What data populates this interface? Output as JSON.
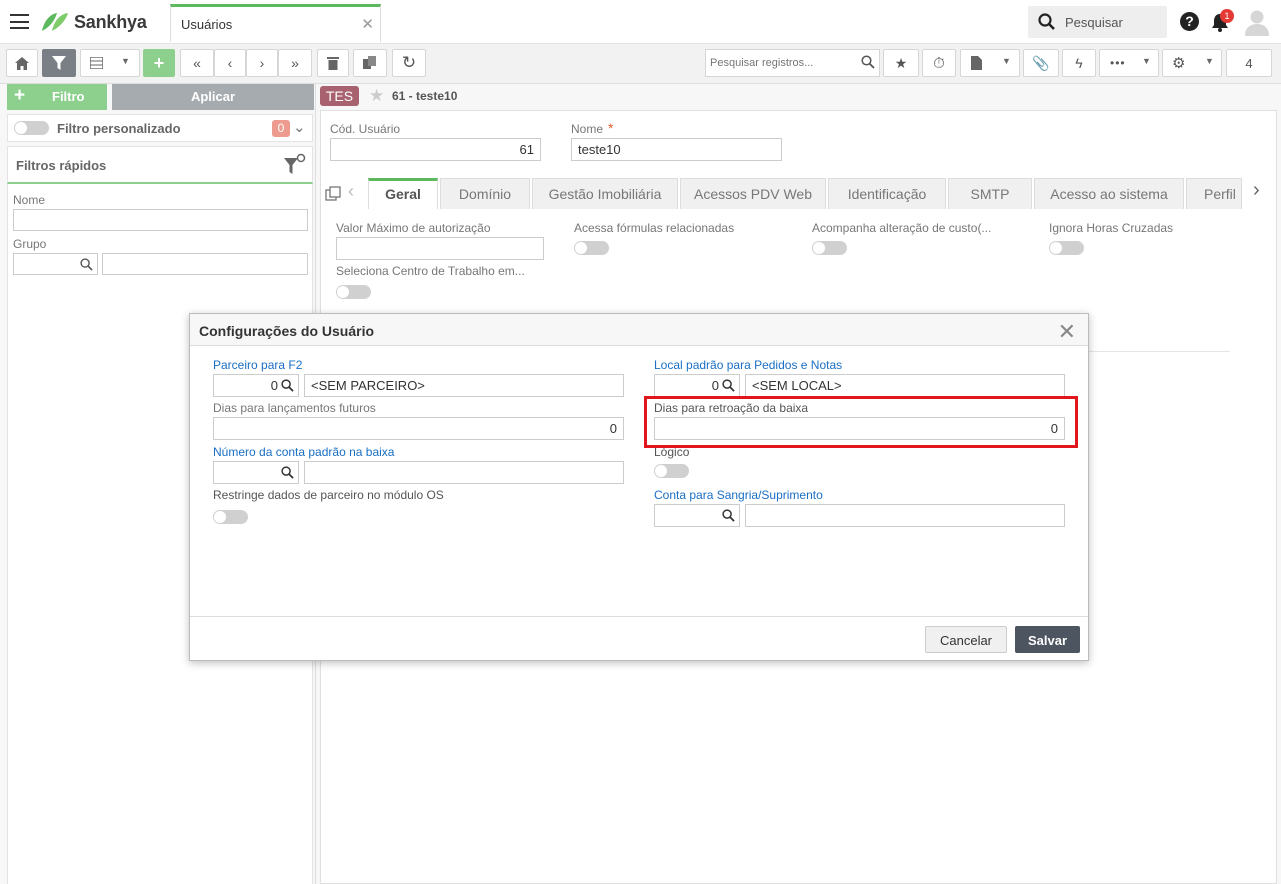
{
  "app": {
    "brand": "Sankhya",
    "tab_title": "Usuários",
    "search_label": "Pesquisar",
    "notification_count": "1"
  },
  "toolbar": {
    "records_search_placeholder": "Pesquisar registros...",
    "page_count": "4"
  },
  "left_panel": {
    "filter_button": "Filtro",
    "apply_button": "Aplicar",
    "custom_filter_label": "Filtro personalizado",
    "custom_filter_count": "0",
    "quick_filters_label": "Filtros rápidos",
    "fields": {
      "name_label": "Nome",
      "group_label": "Grupo"
    }
  },
  "record": {
    "badge": "TES",
    "title": "61 - teste10"
  },
  "form": {
    "user_code_label": "Cód. Usuário",
    "user_code_value": "61",
    "name_label": "Nome",
    "name_required_mark": "*",
    "name_value": "teste10",
    "tabs": [
      "Geral",
      "Domínio",
      "Gestão Imobiliária",
      "Acessos PDV Web",
      "Identificação",
      "SMTP",
      "Acesso ao sistema",
      "Perfil"
    ],
    "geral": {
      "max_auth_label": "Valor Máximo de autorização",
      "related_formulas_label": "Acessa fórmulas relacionadas",
      "cost_change_label": "Acompanha alteração de custo(...",
      "ignore_hours_label": "Ignora Horas Cruzadas",
      "work_center_label": "Seleciona Centro de Trabalho em..."
    }
  },
  "dialog": {
    "title": "Configurações do Usuário",
    "partner_f2_label": "Parceiro para F2",
    "partner_f2_code": "0",
    "partner_f2_desc": "<SEM PARCEIRO>",
    "default_location_label": "Local padrão para Pedidos e Notas",
    "default_location_code": "0",
    "default_location_desc": "<SEM LOCAL>",
    "future_days_label": "Dias para lançamentos futuros",
    "future_days_value": "0",
    "retro_days_label": "Dias para retroação da baixa",
    "retro_days_value": "0",
    "account_label": "Número da conta padrão na baixa",
    "logico_label": "Lógico",
    "restrict_partner_label": "Restringe dados de parceiro no módulo OS",
    "sangria_label": "Conta para Sangria/Suprimento",
    "cancel_button": "Cancelar",
    "save_button": "Salvar"
  },
  "colors": {
    "accent_green": "#5cb85c",
    "highlight_red": "#e0161c",
    "tes_badge": "#a8616f",
    "save_button": "#4d5560"
  }
}
